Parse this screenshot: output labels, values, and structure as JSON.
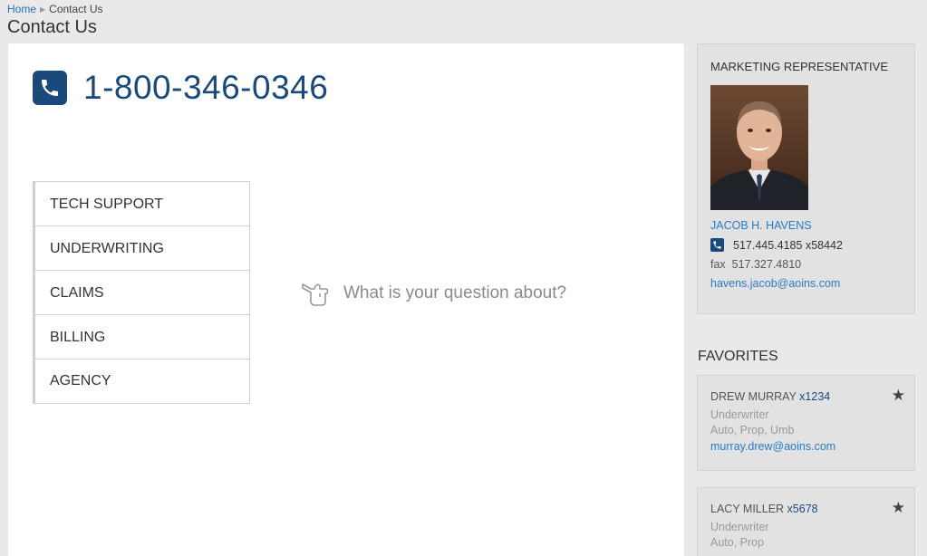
{
  "breadcrumb": {
    "home": "Home",
    "current": "Contact Us"
  },
  "page_title": "Contact Us",
  "main": {
    "phone_number": "1-800-346-0346",
    "departments": [
      "TECH SUPPORT",
      "UNDERWRITING",
      "CLAIMS",
      "BILLING",
      "AGENCY"
    ],
    "prompt": "What is your question about?"
  },
  "representative": {
    "heading": "MARKETING REPRESENTATIVE",
    "name": "JACOB H. HAVENS",
    "phone": "517.445.4185 x58442",
    "fax_label": "fax",
    "fax": "517.327.4810",
    "email": "havens.jacob@aoins.com"
  },
  "favorites": {
    "heading": "FAVORITES",
    "items": [
      {
        "name": "DREW MURRAY",
        "ext": "x1234",
        "title": "Underwriter",
        "lines": "Auto, Prop, Umb",
        "email": "murray.drew@aoins.com"
      },
      {
        "name": "LACY MILLER",
        "ext": "x5678",
        "title": "Underwriter",
        "lines": "Auto, Prop",
        "email": ""
      }
    ]
  },
  "colors": {
    "brand": "#1b4a7a",
    "link": "#2a7bc8",
    "background": "#e9e9e9"
  }
}
